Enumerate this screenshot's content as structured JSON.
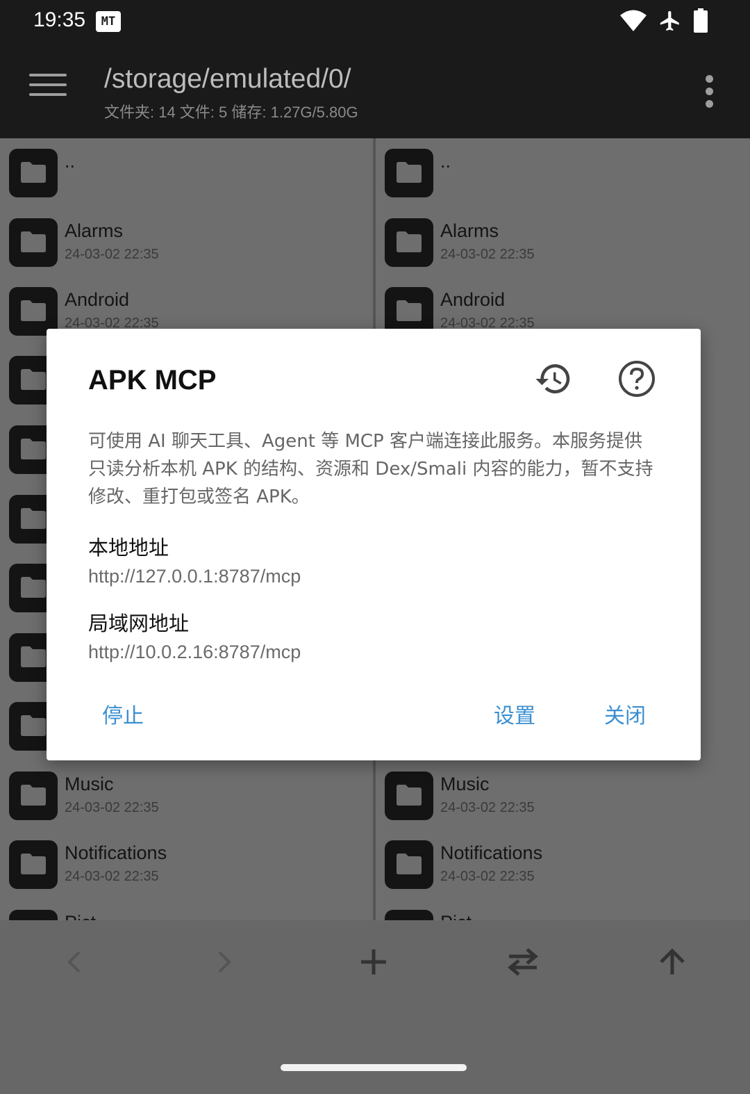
{
  "status_bar": {
    "time": "19:35",
    "app_badge": "MT",
    "icons": [
      "wifi-icon",
      "airplane-icon",
      "battery-icon"
    ]
  },
  "toolbar": {
    "path": "/storage/emulated/0/",
    "summary": "文件夹: 14  文件: 5  储存: 1.27G/5.80G",
    "icons": [
      "menu-icon",
      "more-vert-icon"
    ]
  },
  "left_pane": {
    "items": [
      {
        "name": "..",
        "date": ""
      },
      {
        "name": "Alarms",
        "date": "24-03-02 22:35"
      },
      {
        "name": "Android",
        "date": "24-03-02 22:35"
      },
      {
        "name": "",
        "date": ""
      },
      {
        "name": "",
        "date": ""
      },
      {
        "name": "",
        "date": ""
      },
      {
        "name": "",
        "date": ""
      },
      {
        "name": "",
        "date": ""
      },
      {
        "name": "",
        "date": ""
      },
      {
        "name": "Music",
        "date": "24-03-02 22:35"
      },
      {
        "name": "Notifications",
        "date": "24-03-02 22:35"
      },
      {
        "name": "Pict",
        "date": ""
      }
    ]
  },
  "right_pane": {
    "items": [
      {
        "name": "..",
        "date": ""
      },
      {
        "name": "Alarms",
        "date": "24-03-02 22:35"
      },
      {
        "name": "Android",
        "date": "24-03-02 22:35"
      },
      {
        "name": "Music",
        "date": "24-03-02 22:35"
      },
      {
        "name": "Notifications",
        "date": "24-03-02 22:35"
      },
      {
        "name": "Pict",
        "date": ""
      }
    ]
  },
  "dialog": {
    "title": "APK MCP",
    "description": "可使用 AI 聊天工具、Agent 等 MCP 客户端连接此服务。本服务提供只读分析本机 APK 的结构、资源和 Dex/Smali 内容的能力，暂不支持修改、重打包或签名 APK。",
    "local_label": "本地地址",
    "local_url": "http://127.0.0.1:8787/mcp",
    "lan_label": "局域网地址",
    "lan_url": "http://10.0.2.16:8787/mcp",
    "buttons": {
      "stop": "停止",
      "settings": "设置",
      "close": "关闭"
    },
    "icons": [
      "history-icon",
      "help-icon"
    ],
    "accent_color": "#3a8fd1"
  },
  "bottom_bar": {
    "icons": [
      "back-arrow-icon",
      "forward-arrow-icon",
      "add-icon",
      "swap-icon",
      "up-arrow-icon"
    ]
  }
}
